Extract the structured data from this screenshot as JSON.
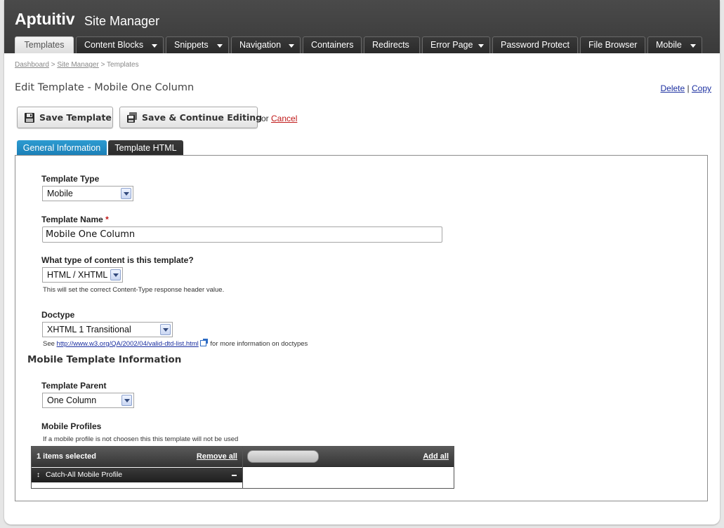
{
  "app": {
    "brand": "Aptuitiv",
    "section": "Site Manager"
  },
  "nav_tabs": [
    {
      "label": "Templates",
      "active": true,
      "dropdown": false
    },
    {
      "label": "Content Blocks",
      "active": false,
      "dropdown": true
    },
    {
      "label": "Snippets",
      "active": false,
      "dropdown": true
    },
    {
      "label": "Navigation",
      "active": false,
      "dropdown": true
    },
    {
      "label": "Containers",
      "active": false,
      "dropdown": false
    },
    {
      "label": "Redirects",
      "active": false,
      "dropdown": false
    },
    {
      "label": "Error Page",
      "active": false,
      "dropdown": true
    },
    {
      "label": "Password Protect",
      "active": false,
      "dropdown": false
    },
    {
      "label": "File Browser",
      "active": false,
      "dropdown": false
    },
    {
      "label": "Mobile",
      "active": false,
      "dropdown": true
    }
  ],
  "breadcrumb": {
    "items": [
      "Dashboard",
      "Site Manager",
      "Templates"
    ],
    "separator": ">"
  },
  "page": {
    "title": "Edit Template - Mobile One Column",
    "delete_label": "Delete",
    "link_separator": "|",
    "copy_label": "Copy"
  },
  "actions": {
    "save_label": "Save Template",
    "save_continue_label": "Save & Continue Editing",
    "or_text": "or",
    "cancel_label": "Cancel"
  },
  "panel_tabs": [
    {
      "label": "General Information",
      "active": true
    },
    {
      "label": "Template HTML",
      "active": false
    }
  ],
  "form": {
    "template_type": {
      "label": "Template Type",
      "value": "Mobile"
    },
    "template_name": {
      "label": "Template Name",
      "required_marker": "*",
      "value": "Mobile One Column"
    },
    "content_type": {
      "label": "What type of content is this template?",
      "value": "HTML / XHTML",
      "help": "This will set the correct Content-Type response header value."
    },
    "doctype": {
      "label": "Doctype",
      "value": "XHTML 1 Transitional",
      "help_prefix": "See",
      "help_link": "http://www.w3.org/QA/2002/04/valid-dtd-list.html",
      "help_suffix": "for more information on doctypes"
    },
    "mobile_section_heading": "Mobile Template Information",
    "template_parent": {
      "label": "Template Parent",
      "value": "One Column"
    },
    "mobile_profiles": {
      "label": "Mobile Profiles",
      "help": "If a mobile profile is not choosen this this template will not be used",
      "selected_count": "1 items selected",
      "remove_all_label": "Remove all",
      "add_all_label": "Add all",
      "selected_items": [
        "Catch-All Mobile Profile"
      ]
    }
  },
  "colors": {
    "header_bg": "#3f3f3f",
    "active_panel_tab": "#1f88c0",
    "link": "#1b2fa0",
    "cancel_link": "#c01818"
  }
}
